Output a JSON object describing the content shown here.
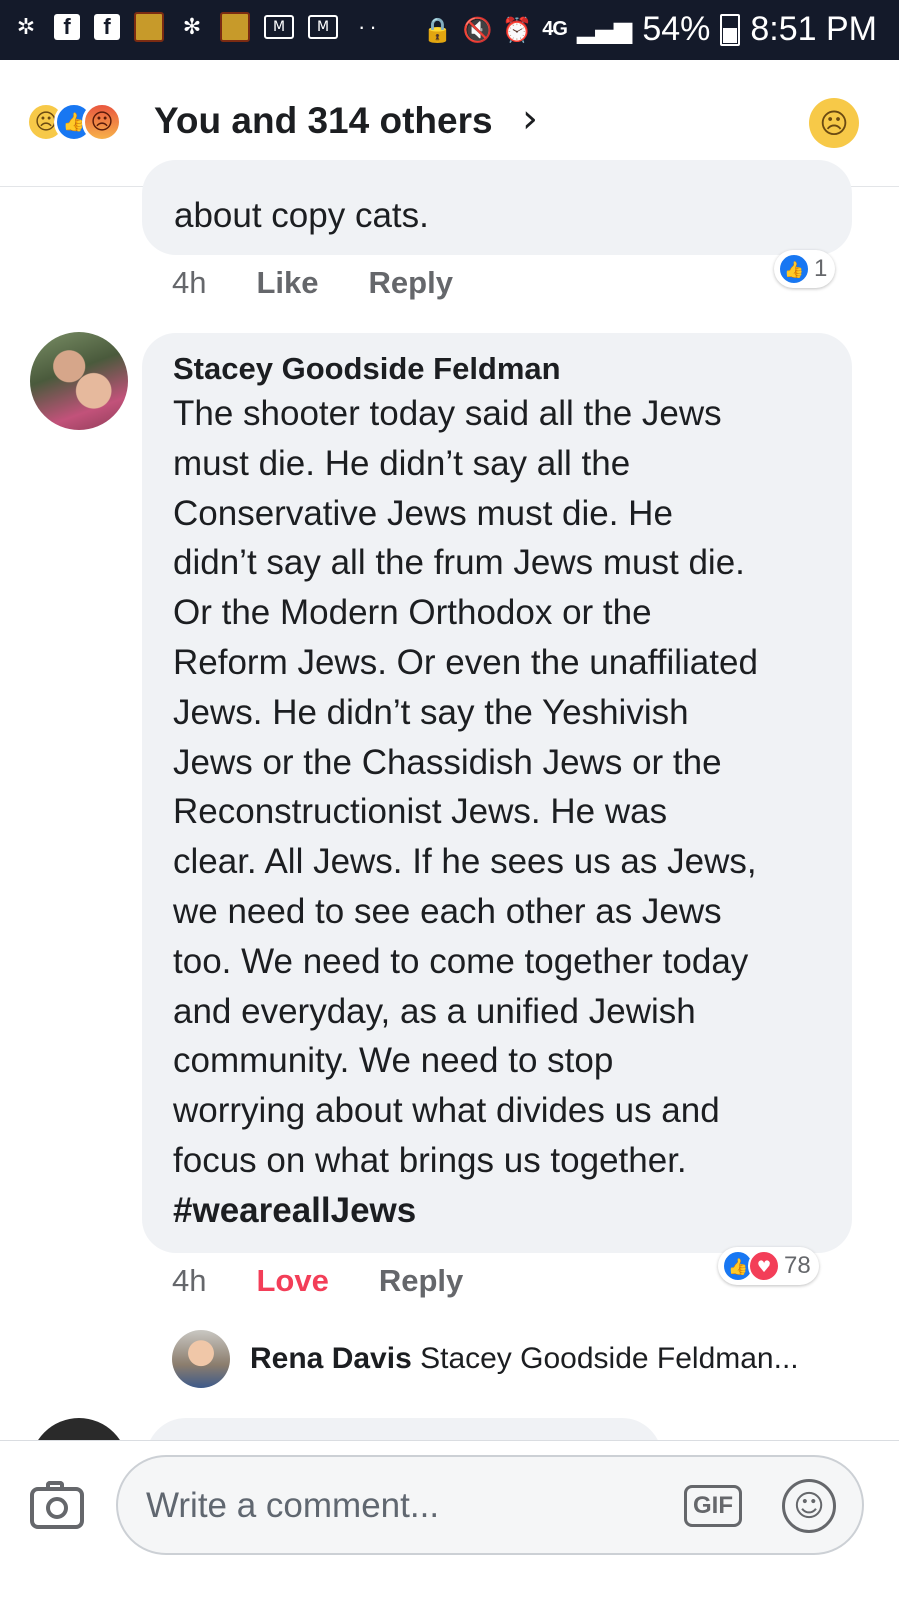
{
  "status_bar": {
    "icons": [
      "settings-icon",
      "facebook-icon",
      "facebook-icon",
      "game-icon",
      "slack-icon",
      "game-icon",
      "gmail-icon",
      "mail-icon",
      "more-dots-icon"
    ],
    "network": "4G",
    "battery": "54%",
    "time": "8:51 PM"
  },
  "reactions_header": {
    "reaction_icons": [
      "sad-icon",
      "like-icon",
      "angry-icon"
    ],
    "summary": "You and 314 others",
    "my_reaction": "sad-icon"
  },
  "comments": [
    {
      "text_tail": "about copy cats.",
      "time": "4h",
      "action_like": "Like",
      "action_reply": "Reply",
      "reactions": [
        "like"
      ],
      "reaction_count": "1"
    },
    {
      "author": "Stacey Goodside Feldman",
      "lines": [
        "The shooter today said all the Jews",
        "must die. He didn’t say all the",
        "Conservative Jews must die. He",
        "didn’t say all the frum Jews must die.",
        "Or the Modern Orthodox or the",
        "Reform Jews. Or even the unaffiliated",
        "Jews. He didn’t say the Yeshivish",
        "Jews or the Chassidish Jews or the",
        "Reconstructionist Jews. He was",
        "clear. All Jews. If he sees us as Jews,",
        "we need to see each other as Jews",
        "too. We need to come together today",
        "and everyday, as a unified Jewish",
        "community. We need to stop",
        "worrying about what divides us and",
        "focus on what brings us together."
      ],
      "hashtag": "#weareallJews",
      "time": "4h",
      "action_love": "Love",
      "action_reply": "Reply",
      "reactions": [
        "like",
        "love"
      ],
      "reaction_count": "78",
      "reply_preview": {
        "author": "Rena Davis",
        "text": "Stacey Goodside Feldman..."
      }
    }
  ],
  "composer": {
    "placeholder": "Write a comment...",
    "gif_label": "GIF"
  },
  "colors": {
    "status_bar_bg": "#141a2a",
    "bubble_bg": "#f0f2f5",
    "like_blue": "#1877f2",
    "love_red": "#f33e58",
    "meta_gray": "#65676b"
  }
}
